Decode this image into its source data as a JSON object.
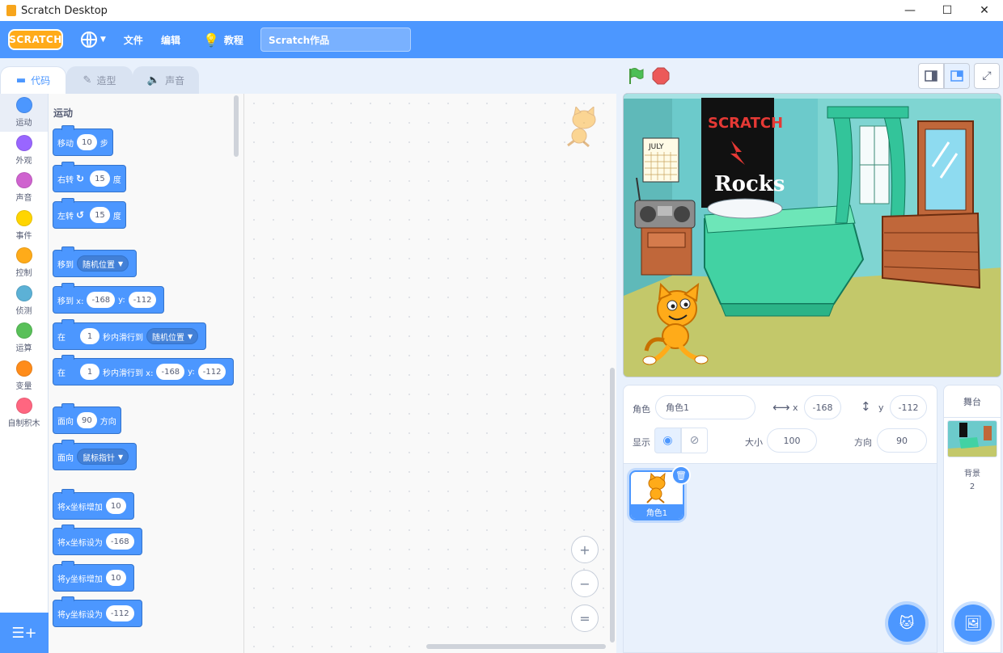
{
  "window": {
    "title": "Scratch Desktop",
    "minimize": "—",
    "maximize": "☐",
    "close": "✕"
  },
  "menubar": {
    "logo": "SCRATCH",
    "file": "文件",
    "edit": "编辑",
    "tutorials": "教程",
    "project_name": "Scratch作品"
  },
  "tabs": {
    "code": "代码",
    "costumes": "造型",
    "sounds": "声音"
  },
  "categories": [
    {
      "label": "运动",
      "color": "#4c97ff"
    },
    {
      "label": "外观",
      "color": "#9966ff"
    },
    {
      "label": "声音",
      "color": "#cf63cf"
    },
    {
      "label": "事件",
      "color": "#ffd500"
    },
    {
      "label": "控制",
      "color": "#ffab19"
    },
    {
      "label": "侦测",
      "color": "#5cb1d6"
    },
    {
      "label": "运算",
      "color": "#59c059"
    },
    {
      "label": "变量",
      "color": "#ff8c1a"
    },
    {
      "label": "自制积木",
      "color": "#ff6680"
    }
  ],
  "palette": {
    "title": "运动",
    "move": {
      "a": "移动",
      "v": "10",
      "b": "步"
    },
    "turn_right": {
      "a": "右转",
      "v": "15",
      "b": "度"
    },
    "turn_left": {
      "a": "左转",
      "v": "15",
      "b": "度"
    },
    "goto": {
      "a": "移到",
      "d": "随机位置"
    },
    "goto_xy": {
      "a": "移到 x:",
      "x": "-168",
      "b": "y:",
      "y": "-112"
    },
    "glide": {
      "a": "在",
      "v": "1",
      "b": "秒内滑行到",
      "d": "随机位置"
    },
    "glide_xy": {
      "a": "在",
      "v": "1",
      "b": "秒内滑行到 x:",
      "x": "-168",
      "c": "y:",
      "y": "-112"
    },
    "point_dir": {
      "a": "面向",
      "v": "90",
      "b": "方向"
    },
    "point_to": {
      "a": "面向",
      "d": "鼠标指针"
    },
    "change_x": {
      "a": "将x坐标增加",
      "v": "10"
    },
    "set_x": {
      "a": "将x坐标设为",
      "v": "-168"
    },
    "change_y": {
      "a": "将y坐标增加",
      "v": "10"
    },
    "set_y": {
      "a": "将y坐标设为",
      "v": "-112"
    }
  },
  "zoom": {
    "in": "+",
    "out": "−",
    "reset": "="
  },
  "sprite_info": {
    "sprite_label": "角色",
    "sprite_name": "角色1",
    "x_label": "x",
    "x": "-168",
    "y_label": "y",
    "y": "-112",
    "show_label": "显示",
    "size_label": "大小",
    "size": "100",
    "direction_label": "方向",
    "direction": "90"
  },
  "sprites": [
    {
      "name": "角色1"
    }
  ],
  "stage_pane": {
    "title": "舞台",
    "backdrops_label": "背景",
    "backdrops_count": "2"
  },
  "poster": {
    "line1": "SCRATCH",
    "line2": "Rocks"
  },
  "calendar": "JULY"
}
